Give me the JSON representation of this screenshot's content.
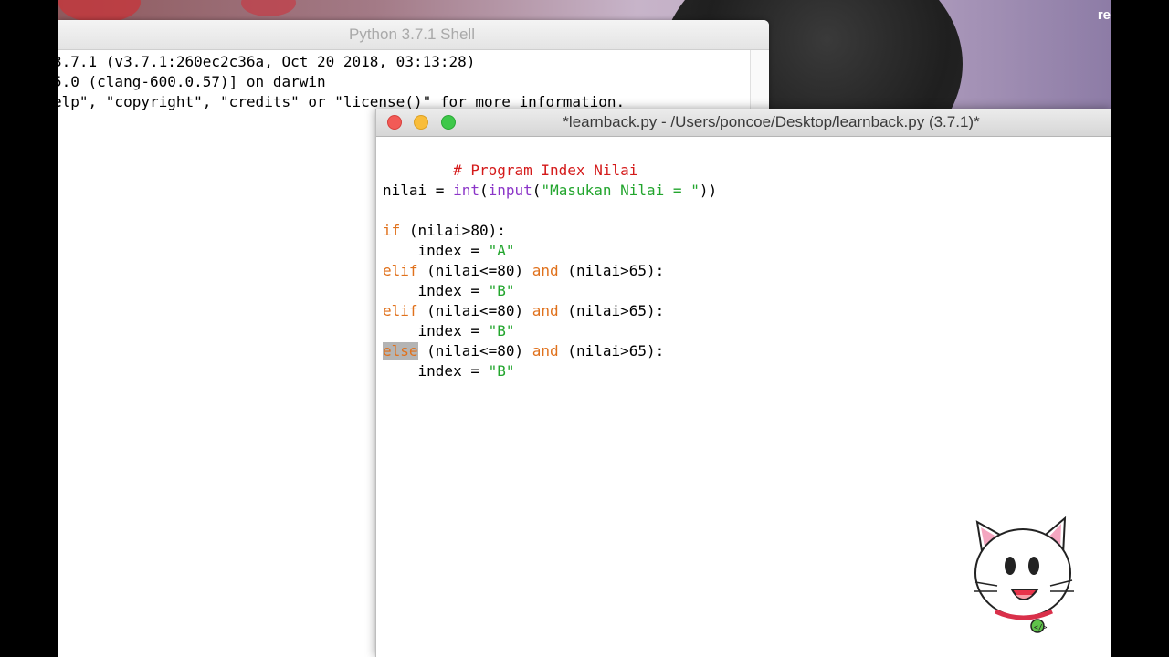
{
  "wallpaper": {
    "corner_text": "re"
  },
  "shell": {
    "title": "Python 3.7.1 Shell",
    "lines": [
      "3.7.1 (v3.7.1:260ec2c36a, Oct 20 2018, 03:13:28)",
      "5.0 (clang-600.0.57)] on darwin",
      "elp\", \"copyright\", \"credits\" or \"license()\" for more information."
    ]
  },
  "editor": {
    "title": "*learnback.py - /Users/poncoe/Desktop/learnback.py (3.7.1)*",
    "code": {
      "line1": {
        "comment": "# Program Index Nilai"
      },
      "line3": {
        "var": "nilai",
        "eq": " = ",
        "int": "int",
        "paren1": "(",
        "input": "input",
        "paren2": "(",
        "str": "\"Masukan Nilai = \"",
        "close": "))"
      },
      "line5": {
        "kw": "if",
        "rest": " (nilai>80):"
      },
      "line6": {
        "indent": "    index = ",
        "str": "\"A\""
      },
      "line7": {
        "kw": "elif",
        "mid": " (nilai<=80) ",
        "and": "and",
        "rest": " (nilai>65):"
      },
      "line8": {
        "indent": "    index = ",
        "str": "\"B\""
      },
      "line9": {
        "kw": "elif",
        "mid": " (nilai<=80) ",
        "and": "and",
        "rest": " (nilai>65):"
      },
      "line10": {
        "indent": "    index = ",
        "str": "\"B\""
      },
      "line11": {
        "kw": "else",
        "mid": " (nilai<=80) ",
        "and": "and",
        "rest": " (nilai>65):"
      },
      "line12": {
        "indent": "    index = ",
        "str": "\"B\""
      }
    },
    "colors": {
      "comment": "#d41a1a",
      "keyword": "#e0711c",
      "builtin": "#8b35c8",
      "string": "#22a52d"
    }
  },
  "mascot": {
    "icon": "cat-mascot-icon"
  }
}
